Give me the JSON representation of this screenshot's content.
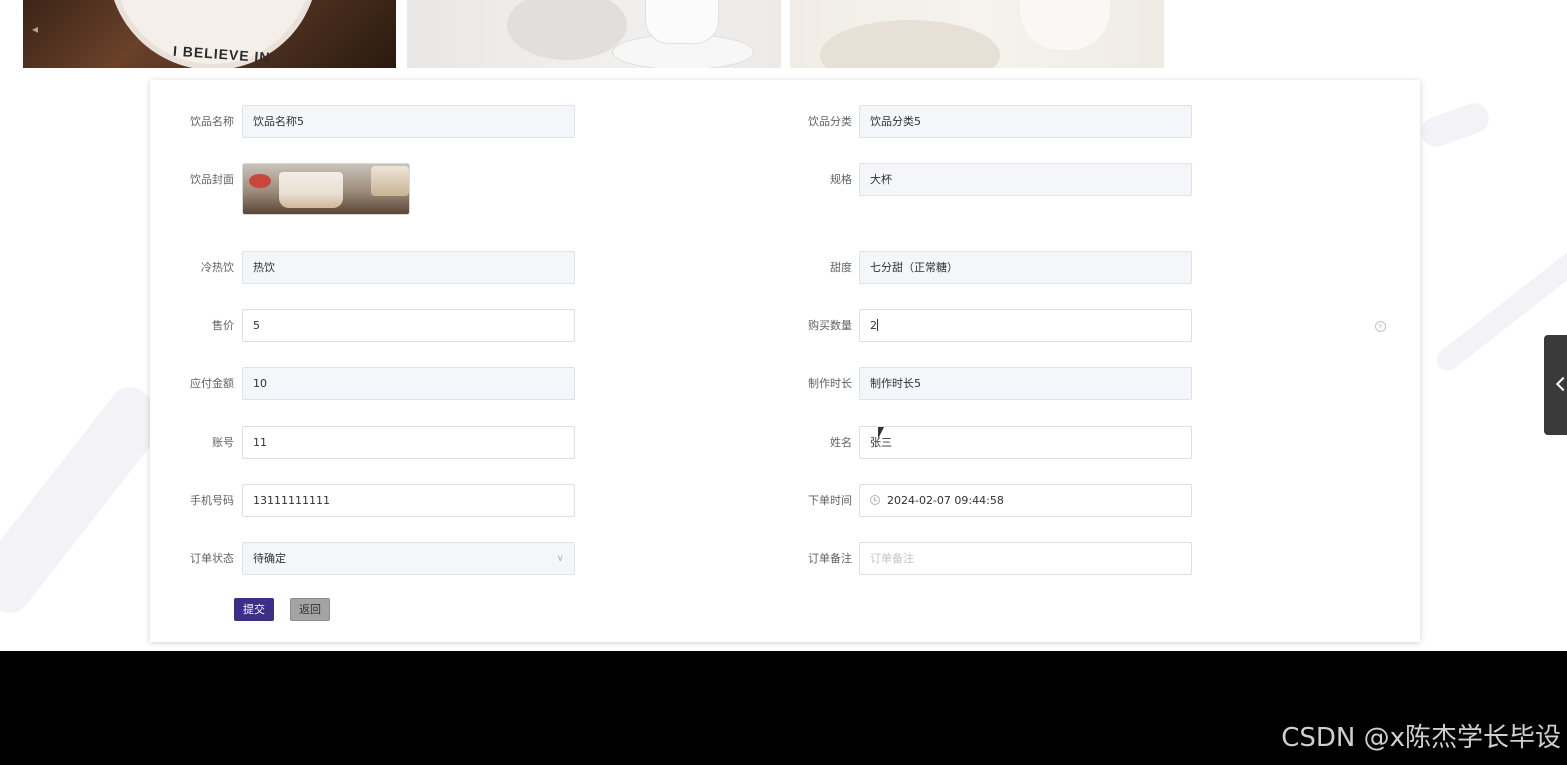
{
  "banner": {
    "cup_text": "I BELIEVE IN"
  },
  "form": {
    "drink_name": {
      "label": "饮品名称",
      "value": "饮品名称5"
    },
    "drink_category": {
      "label": "饮品分类",
      "value": "饮品分类5"
    },
    "drink_cover": {
      "label": "饮品封面"
    },
    "spec": {
      "label": "规格",
      "value": "大杯"
    },
    "temperature": {
      "label": "冷热饮",
      "value": "热饮"
    },
    "sweetness": {
      "label": "甜度",
      "value": "七分甜（正常糖）"
    },
    "price": {
      "label": "售价",
      "value": "5"
    },
    "quantity": {
      "label": "购买数量",
      "value": "2"
    },
    "amount_due": {
      "label": "应付金额",
      "value": "10"
    },
    "prep_time": {
      "label": "制作时长",
      "value": "制作时长5"
    },
    "account": {
      "label": "账号",
      "value": "11"
    },
    "name": {
      "label": "姓名",
      "value": "张三"
    },
    "phone": {
      "label": "手机号码",
      "value": "13111111111"
    },
    "order_time": {
      "label": "下单时间",
      "value": "2024-02-07 09:44:58"
    },
    "order_status": {
      "label": "订单状态",
      "value": "待确定"
    },
    "order_remark": {
      "label": "订单备注",
      "value": "",
      "placeholder": "订单备注"
    }
  },
  "buttons": {
    "submit": "提交",
    "back": "返回"
  },
  "watermark": "CSDN @x陈杰学长毕设",
  "colors": {
    "primary": "#3b2f86",
    "back_button": "#a4a4a4",
    "readonly_bg": "#f5f6fa",
    "border": "#dcdfe6"
  }
}
